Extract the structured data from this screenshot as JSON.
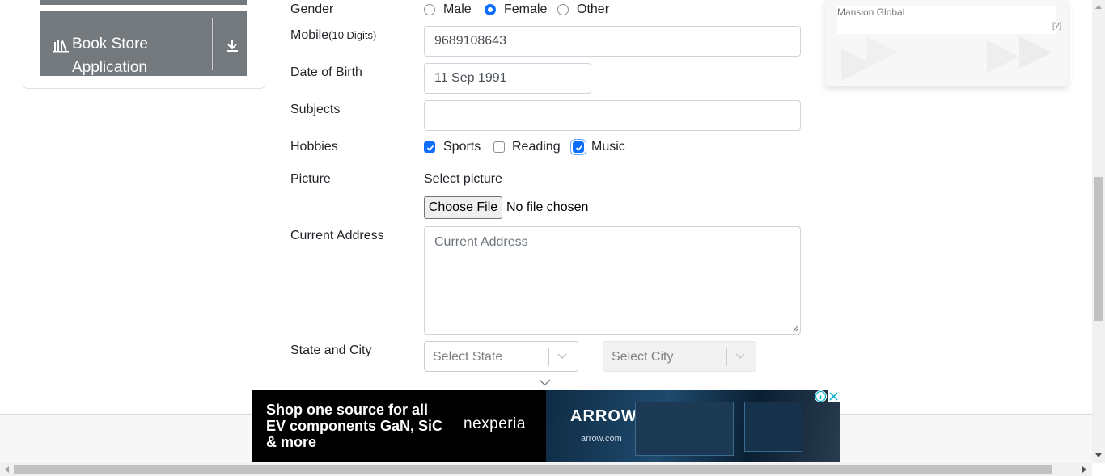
{
  "sidebar": {
    "book_store_line1": "Book Store",
    "book_store_line2": "Application"
  },
  "form": {
    "gender": {
      "label": "Gender",
      "options": [
        "Male",
        "Female",
        "Other"
      ],
      "selected": "Female"
    },
    "mobile": {
      "label": "Mobile",
      "hint": "(10 Digits)",
      "value": "9689108643"
    },
    "dob": {
      "label": "Date of Birth",
      "value": "11 Sep 1991"
    },
    "subjects": {
      "label": "Subjects",
      "value": ""
    },
    "hobbies": {
      "label": "Hobbies",
      "options": [
        "Sports",
        "Reading",
        "Music"
      ],
      "checked": [
        "Sports",
        "Music"
      ]
    },
    "picture": {
      "label": "Picture",
      "select_label": "Select picture",
      "button": "Choose File",
      "status": "No file chosen"
    },
    "address": {
      "label": "Current Address",
      "placeholder": "Current Address"
    },
    "state_city": {
      "label": "State and City",
      "state_placeholder": "Select State",
      "city_placeholder": "Select City"
    }
  },
  "ad_right": {
    "source": "Mansion Global",
    "help": "[?]"
  },
  "ad_banner": {
    "line1": "Shop one source for all",
    "line2": "EV components GaN, SiC",
    "line3": "& more",
    "brand": "nexperia",
    "logo": "ARROW",
    "domain": "arrow.com"
  },
  "colors": {
    "accent": "#0d6efd",
    "sidebar": "#74797e"
  }
}
